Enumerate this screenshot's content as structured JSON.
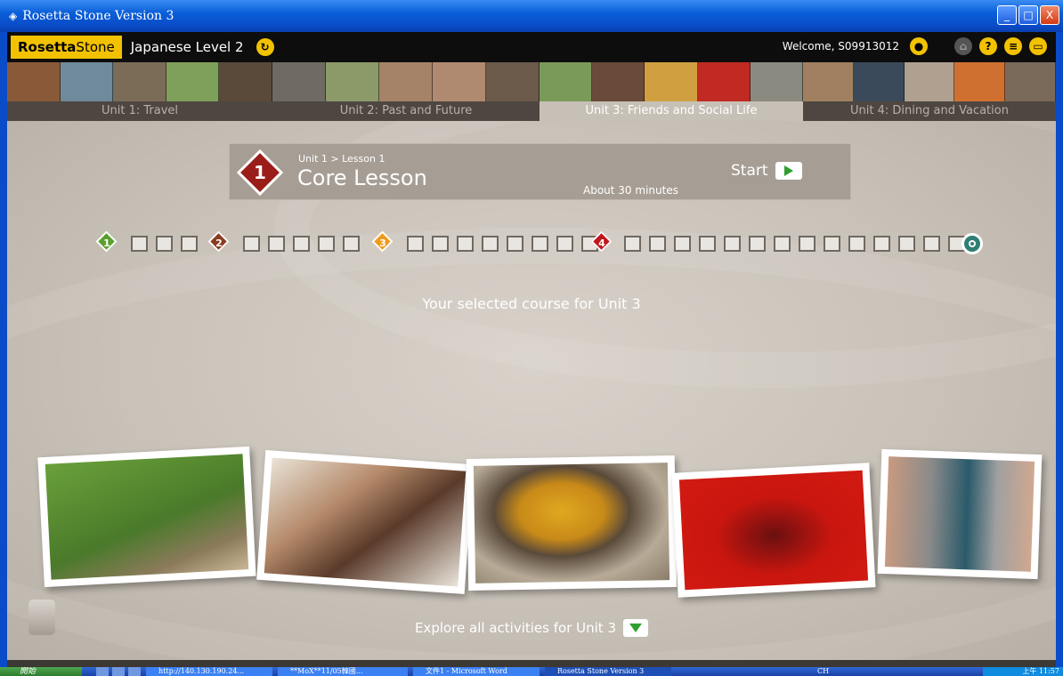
{
  "window": {
    "title": "Rosetta Stone Version 3",
    "controls": {
      "minimize": "_",
      "maximize": "□",
      "close": "X"
    }
  },
  "header": {
    "logo_bold": "Rosetta",
    "logo_thin": "Stone",
    "course": "Japanese Level 2",
    "course_icon": "refresh-icon",
    "welcome": "Welcome, S09913012",
    "icons": [
      "user-icon",
      "home-icon",
      "help-icon",
      "menu-icon",
      "window-icon"
    ]
  },
  "units": [
    {
      "label": "Unit 1: Travel",
      "active": false
    },
    {
      "label": "Unit 2: Past and Future",
      "active": false
    },
    {
      "label": "Unit 3: Friends and Social Life",
      "active": true
    },
    {
      "label": "Unit 4: Dining and Vacation",
      "active": false
    }
  ],
  "lesson": {
    "number": "1",
    "breadcrumb": "Unit 1 > Lesson 1",
    "title": "Core Lesson",
    "duration": "About 30 minutes",
    "start_label": "Start"
  },
  "progress_markers": [
    "1",
    "2",
    "3",
    "4"
  ],
  "selected_course": "Your selected course for Unit 3",
  "photos": [
    "dog-photo",
    "child-painted-hands-photo",
    "soup-photo",
    "flamenco-dancer-photo",
    "balcony-photo"
  ],
  "explore": "Explore all activities for Unit 3",
  "colors": {
    "accent_yellow": "#f2c200",
    "lesson_red": "#9a1d1a",
    "marker_green": "#5aa02c",
    "marker_brown": "#8a3b22",
    "marker_orange": "#f09a1a",
    "marker_red": "#c0161c",
    "end_teal": "#2f7f74"
  },
  "taskbar": {
    "start": "開始",
    "tasks": [
      {
        "label": "http://140.130.190.24...",
        "active": false
      },
      {
        "label": "**MoX**11/05韓國...",
        "active": false
      },
      {
        "label": "文件1 - Microsoft Word",
        "active": false
      },
      {
        "label": "Rosetta Stone Version 3",
        "active": true
      }
    ],
    "lang": "CH",
    "clock": "上午 11:57"
  }
}
